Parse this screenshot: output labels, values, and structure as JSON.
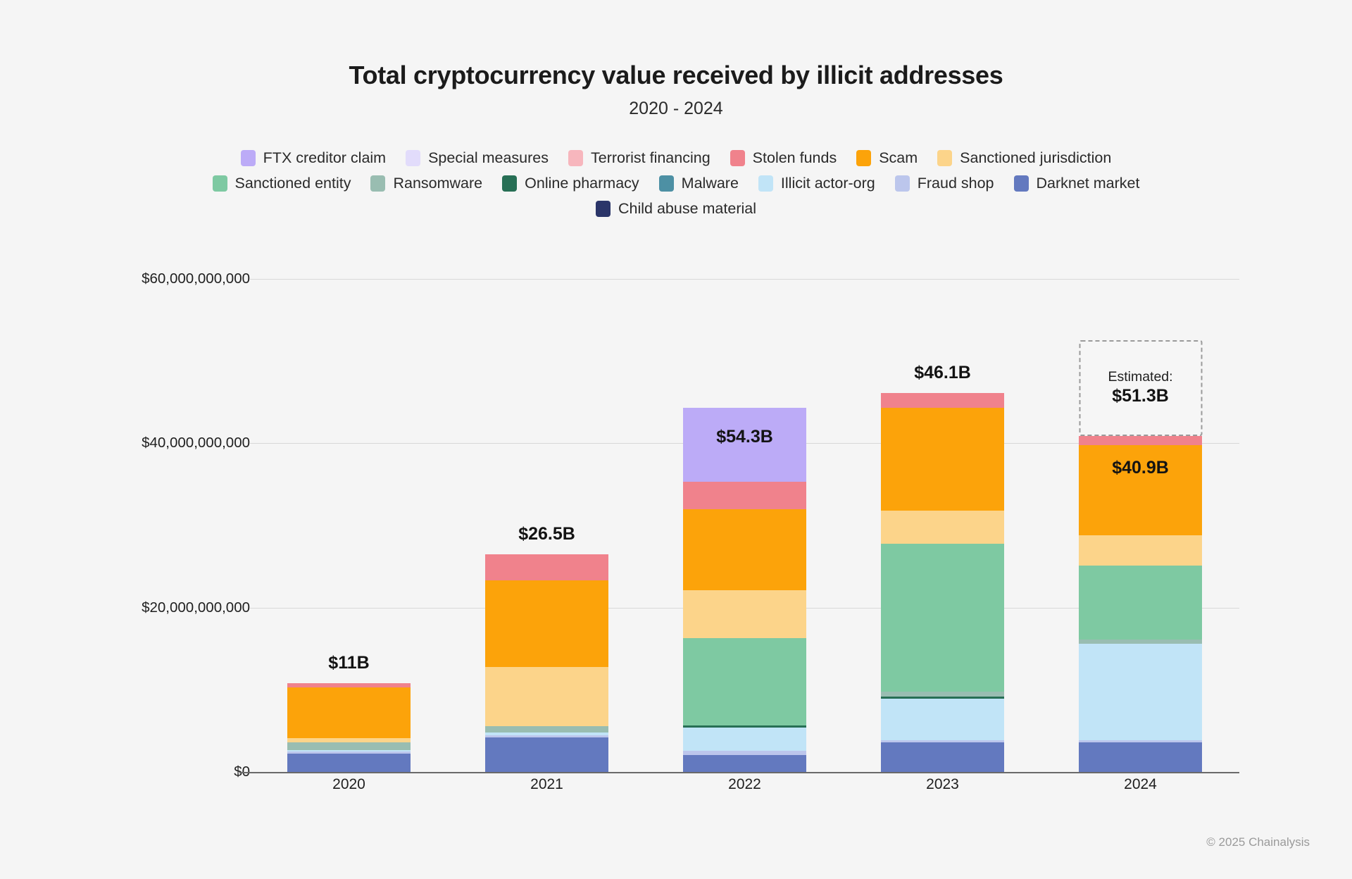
{
  "header": {
    "title": "Total cryptocurrency value received by illicit addresses",
    "subtitle": "2020 - 2024"
  },
  "footer": {
    "copyright": "© 2025 Chainalysis"
  },
  "estimated": {
    "caption": "Estimated:",
    "value": "$51.3B"
  },
  "chart_data": {
    "type": "bar",
    "variant": "stacked",
    "title": "Total cryptocurrency value received by illicit addresses",
    "subtitle": "2020 - 2024",
    "xlabel": "",
    "ylabel": "",
    "ylim": [
      0,
      60000000000
    ],
    "grid": true,
    "legend_position": "top",
    "categories": [
      "2020",
      "2021",
      "2022",
      "2023",
      "2024"
    ],
    "y_ticks": [
      0,
      20000000000,
      40000000000,
      60000000000
    ],
    "y_tick_labels": [
      "$0",
      "$20,000,000,000",
      "$40,000,000,000",
      "$60,000,000,000"
    ],
    "bar_totals": [
      "$11B",
      "$26.5B",
      "$54.3B",
      "$46.1B",
      "$40.9B"
    ],
    "bar_total_values": [
      11.0,
      26.5,
      54.3,
      46.1,
      40.9
    ],
    "estimated_total_2024": 51.3,
    "series": [
      {
        "name": "FTX creditor claim",
        "color": "#bcabf7",
        "values": [
          0,
          0,
          9.0,
          0,
          0
        ]
      },
      {
        "name": "Special measures",
        "color": "#e2dcfb",
        "values": [
          0,
          0,
          0,
          0,
          0
        ]
      },
      {
        "name": "Terrorist financing",
        "color": "#f7b6bd",
        "values": [
          0,
          0,
          0,
          0,
          0
        ]
      },
      {
        "name": "Stolen funds",
        "color": "#f0828c",
        "values": [
          0.5,
          3.2,
          3.3,
          1.8,
          1.1
        ]
      },
      {
        "name": "Scam",
        "color": "#fca30a",
        "values": [
          6.2,
          10.5,
          9.9,
          12.5,
          11.0
        ]
      },
      {
        "name": "Sanctioned jurisdiction",
        "color": "#fcd48a",
        "values": [
          0.5,
          7.2,
          5.8,
          4.0,
          3.7
        ]
      },
      {
        "name": "Sanctioned entity",
        "color": "#7ec9a2",
        "values": [
          0,
          0,
          10.6,
          18.0,
          9.0
        ]
      },
      {
        "name": "Ransomware",
        "color": "#99bdb1",
        "values": [
          0.9,
          0.8,
          0,
          0.6,
          0.5
        ]
      },
      {
        "name": "Online pharmacy",
        "color": "#276f55",
        "values": [
          0,
          0,
          0.3,
          0.3,
          0
        ]
      },
      {
        "name": "Malware",
        "color": "#4d90a4",
        "values": [
          0,
          0,
          0,
          0,
          0
        ]
      },
      {
        "name": "Illicit actor-org",
        "color": "#c1e4f7",
        "values": [
          0.25,
          0.3,
          2.8,
          5.0,
          11.7
        ]
      },
      {
        "name": "Fraud shop",
        "color": "#bcc6ec",
        "values": [
          0.25,
          0.3,
          0.5,
          0.3,
          0.3
        ]
      },
      {
        "name": "Darknet market",
        "color": "#6379bf",
        "values": [
          2.2,
          4.2,
          2.1,
          3.6,
          3.6
        ]
      },
      {
        "name": "Child abuse material",
        "color": "#2b3569",
        "values": [
          0,
          0,
          0,
          0,
          0
        ]
      }
    ]
  }
}
